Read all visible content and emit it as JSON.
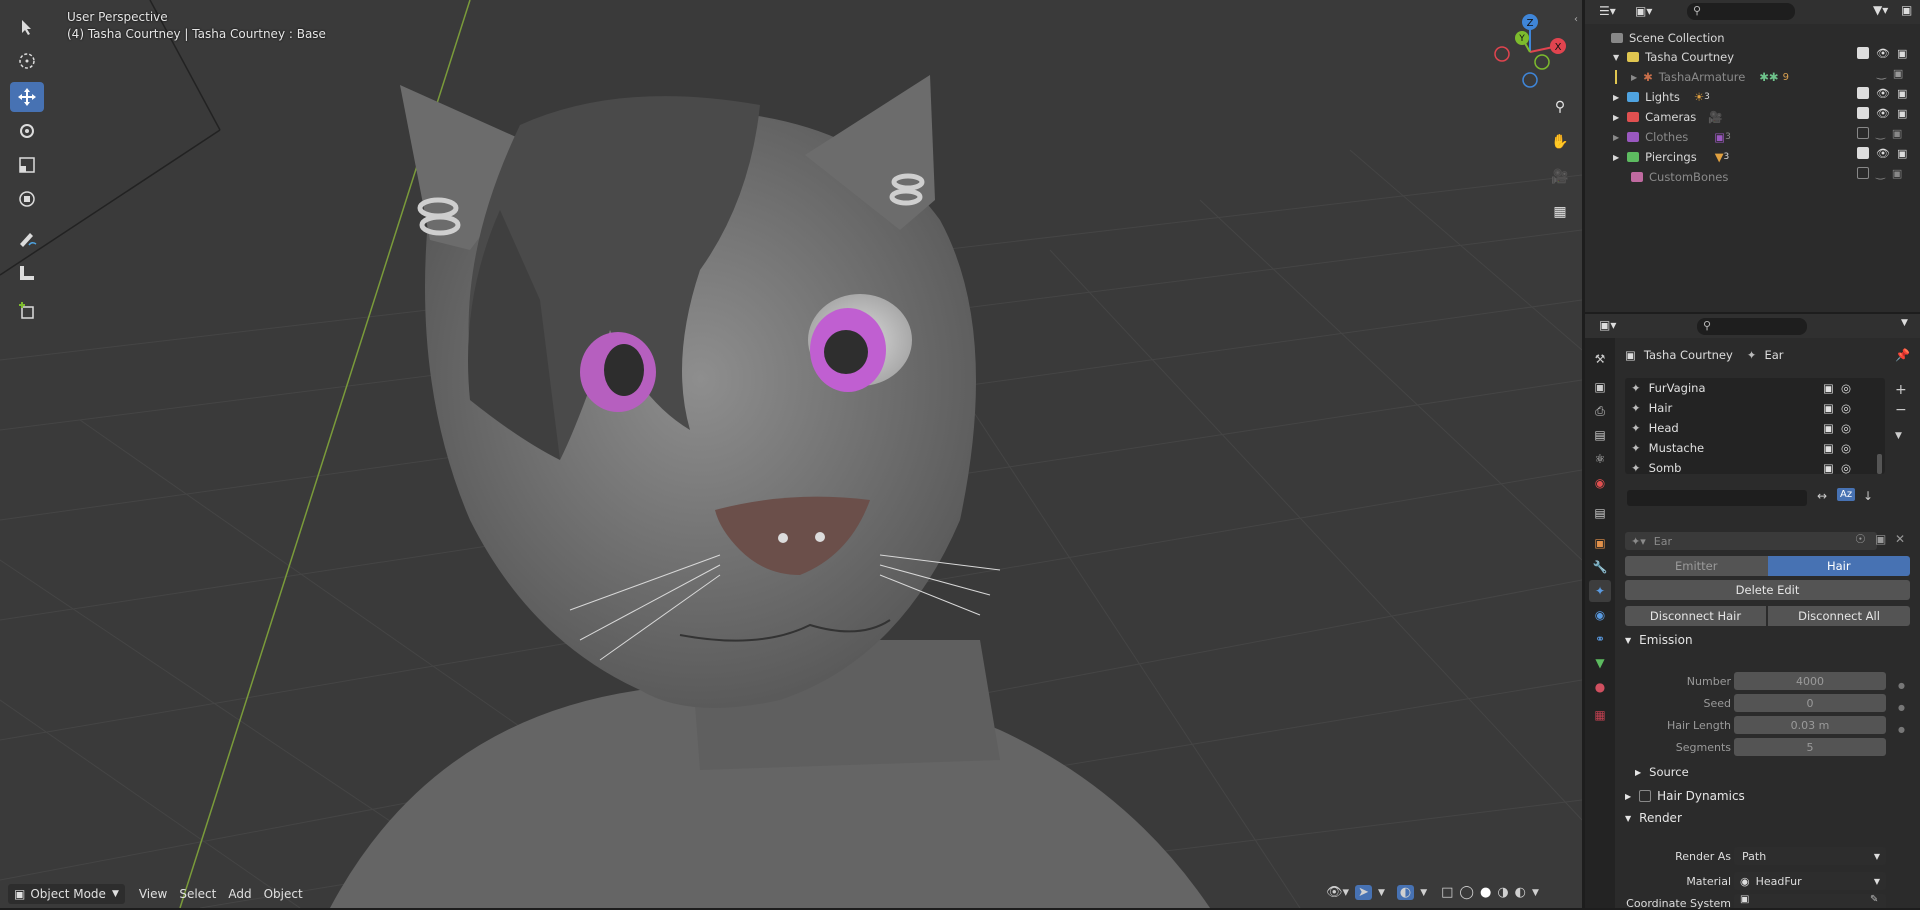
{
  "viewport": {
    "perspective": "User Perspective",
    "object_info": "(4) Tasha Courtney | Tasha Courtney : Base",
    "axes": {
      "x": "X",
      "y": "Y",
      "z": "Z"
    },
    "header": {
      "mode": "Object Mode",
      "menus": [
        "View",
        "Select",
        "Add",
        "Object"
      ]
    },
    "tools": [
      "select-icon",
      "cursor-icon",
      "move-icon",
      "rotate-icon",
      "scale-icon",
      "transform-icon",
      "annotate-icon",
      "measure-icon",
      "add-cube-icon"
    ]
  },
  "outliner": {
    "rows": [
      {
        "label": "Scene Collection",
        "dim": false
      },
      {
        "label": "Tasha Courtney",
        "dim": false
      },
      {
        "label": "TashaArmature",
        "dim": true,
        "badge": "9"
      },
      {
        "label": "Lights",
        "dim": false,
        "badge": "3"
      },
      {
        "label": "Cameras",
        "dim": false
      },
      {
        "label": "Clothes",
        "dim": true,
        "badge": "3"
      },
      {
        "label": "Piercings",
        "dim": false,
        "badge": "3"
      },
      {
        "label": "CustomBones",
        "dim": true
      }
    ]
  },
  "properties": {
    "breadcrumb": {
      "object": "Tasha Courtney",
      "system": "Ear"
    },
    "particle_systems": [
      "FurVagina",
      "Hair",
      "Head",
      "Mustache",
      "Somb"
    ],
    "settings_name": "Ear",
    "type_tabs": [
      "Emitter",
      "Hair"
    ],
    "buttons": {
      "delete_edit": "Delete Edit",
      "disconnect_hair": "Disconnect Hair",
      "disconnect_all": "Disconnect All"
    },
    "emission": {
      "title": "Emission",
      "fields": [
        {
          "label": "Number",
          "value": "4000"
        },
        {
          "label": "Seed",
          "value": "0"
        },
        {
          "label": "Hair Length",
          "value": "0.03 m"
        },
        {
          "label": "Segments",
          "value": "5"
        }
      ],
      "source": "Source"
    },
    "hair_dynamics": "Hair Dynamics",
    "render": {
      "title": "Render",
      "render_as_label": "Render As",
      "render_as_value": "Path",
      "material_label": "Material",
      "material_value": "HeadFur",
      "coord_label": "Coordinate System"
    }
  },
  "colors": {
    "accent": "#4772b3",
    "x_axis": "#e1444f",
    "y_axis": "#7dbb2d",
    "z_axis": "#3f86d9"
  }
}
